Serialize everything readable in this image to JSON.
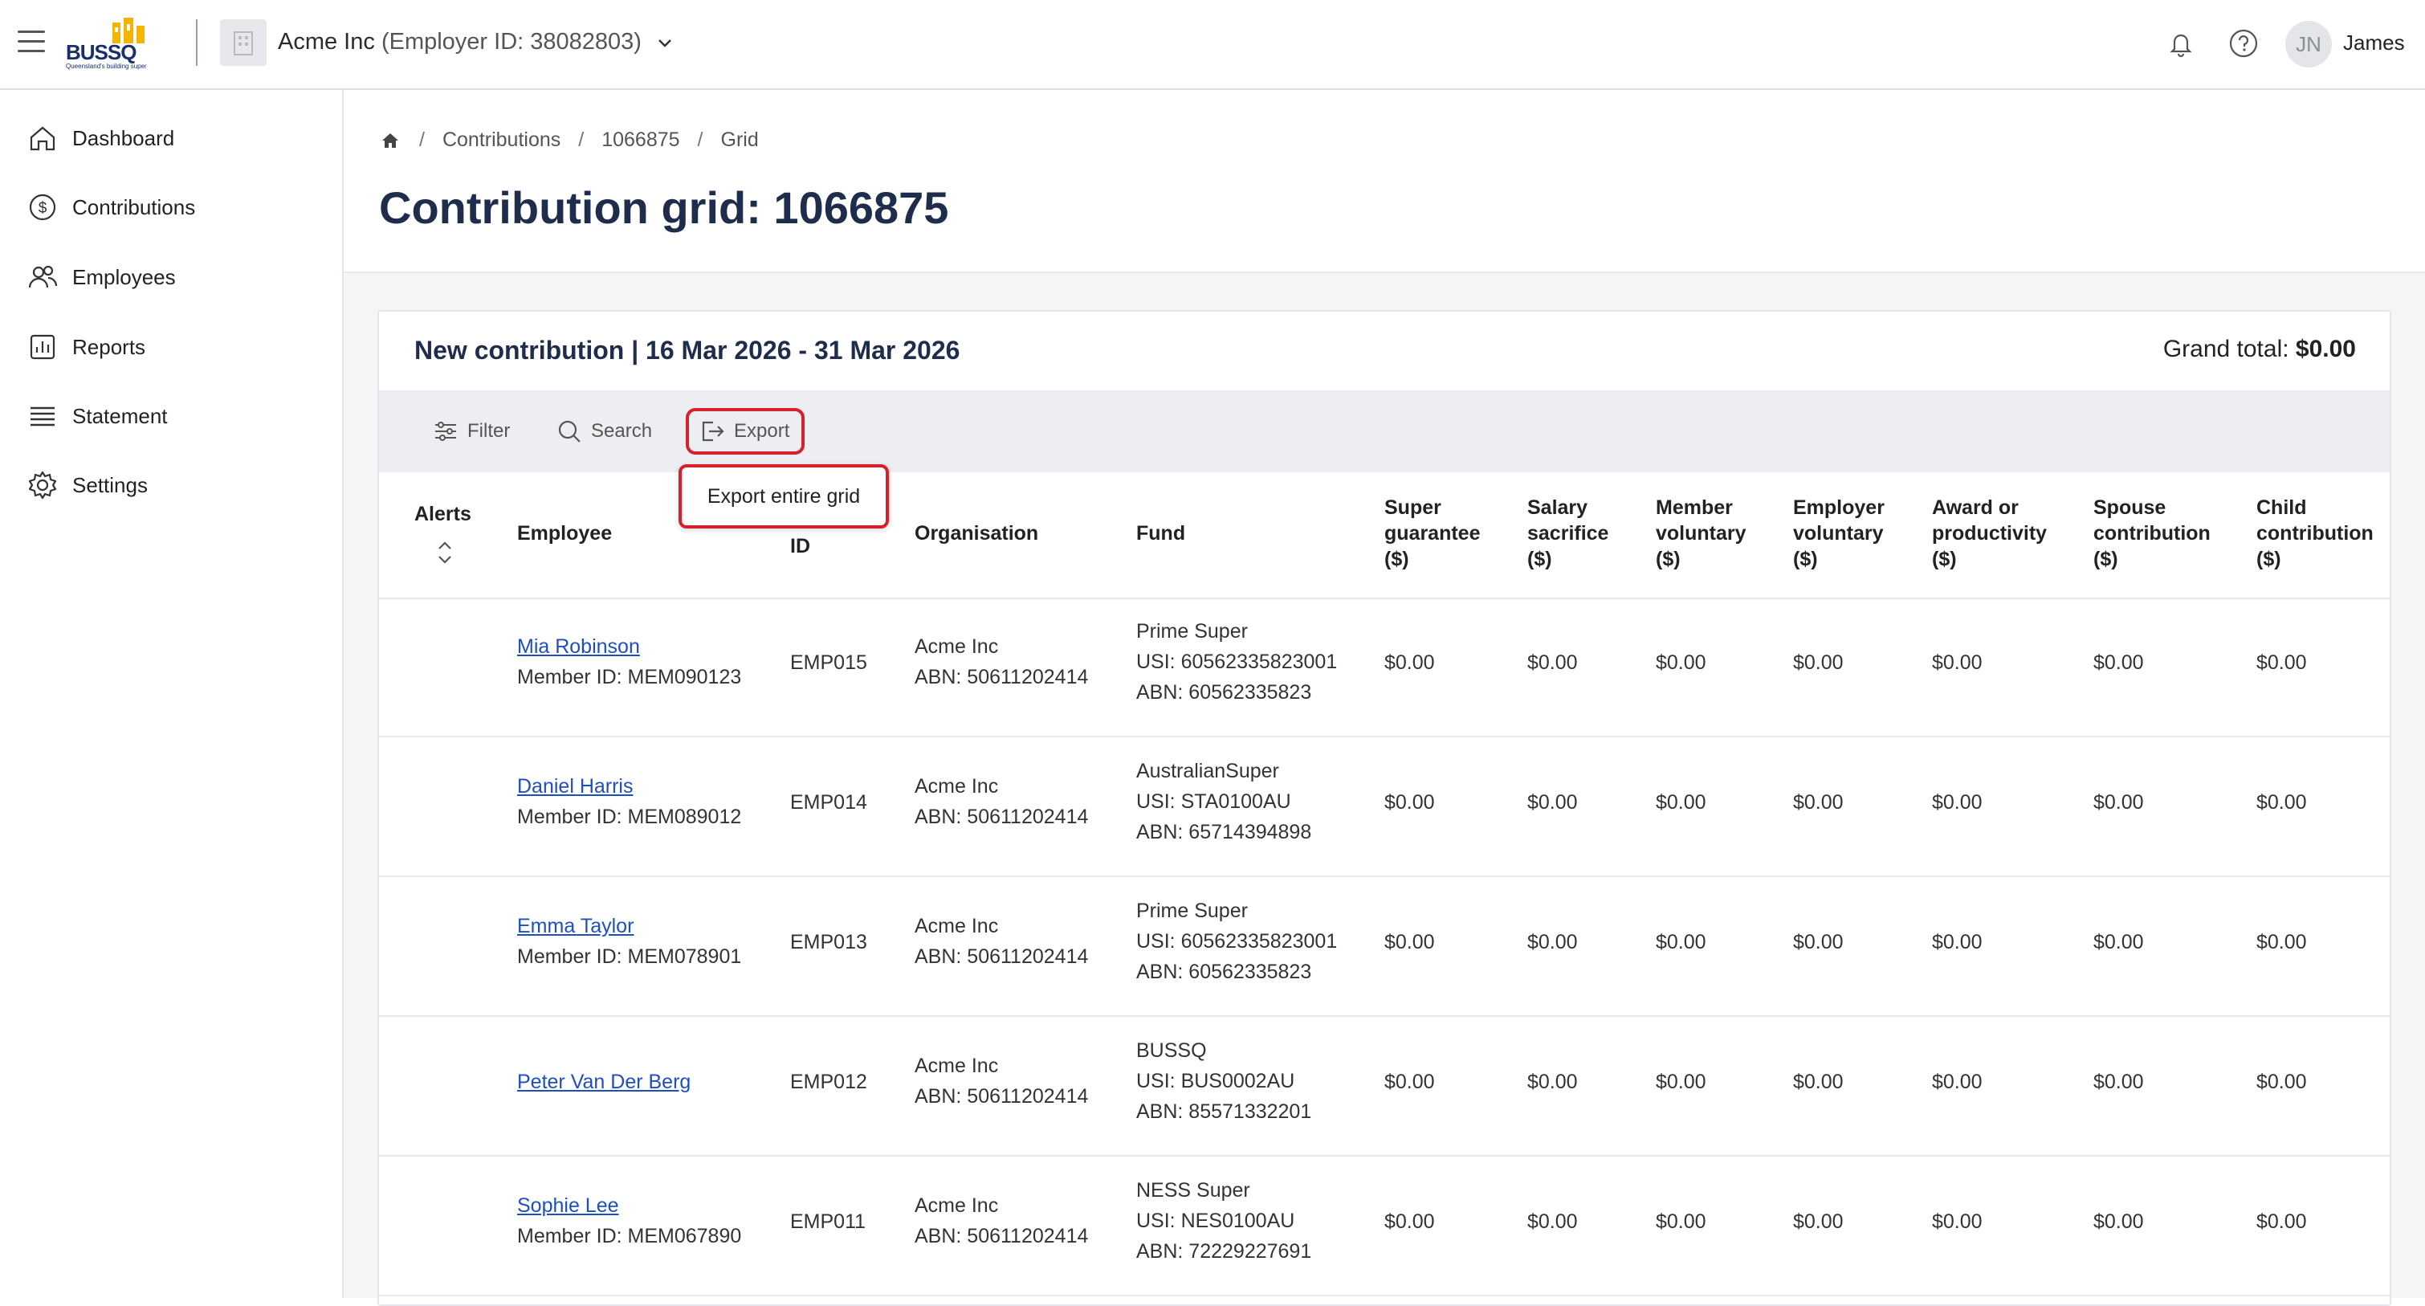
{
  "header": {
    "logo_text": "BUSSQ",
    "logo_tagline": "Queensland's building super",
    "org_name": "Acme Inc",
    "org_id_text": "(Employer ID: 38082803)",
    "avatar_initials": "JN",
    "user_name": "James"
  },
  "sidebar": {
    "items": [
      {
        "label": "Dashboard",
        "icon": "home-icon"
      },
      {
        "label": "Contributions",
        "icon": "dollar-circle-icon"
      },
      {
        "label": "Employees",
        "icon": "people-icon"
      },
      {
        "label": "Reports",
        "icon": "bar-chart-icon"
      },
      {
        "label": "Statement",
        "icon": "list-icon"
      },
      {
        "label": "Settings",
        "icon": "gear-icon"
      }
    ]
  },
  "breadcrumb": [
    "Contributions",
    "1066875",
    "Grid"
  ],
  "page_title": "Contribution grid: 1066875",
  "card": {
    "title": "New contribution | 16 Mar 2026 - 31 Mar 2026",
    "grand_total_label": "Grand total:",
    "grand_total_value": "$0.00"
  },
  "toolbar": {
    "filter_label": "Filter",
    "search_label": "Search",
    "export_label": "Export",
    "export_menu_item": "Export entire grid"
  },
  "table": {
    "headers": {
      "alerts": "Alerts",
      "employee": "Employee",
      "payroll_id_partial": "ID",
      "organisation": "Organisation",
      "fund": "Fund",
      "super_guarantee": [
        "Super",
        "guarantee",
        "($)"
      ],
      "salary_sacrifice": [
        "Salary",
        "sacrifice",
        "($)"
      ],
      "member_voluntary": [
        "Member",
        "voluntary",
        "($)"
      ],
      "employer_voluntary": [
        "Employer",
        "voluntary",
        "($)"
      ],
      "award_productivity": [
        "Award or",
        "productivity",
        "($)"
      ],
      "spouse_contribution": [
        "Spouse",
        "contribution",
        "($)"
      ],
      "child_contribution": [
        "Child",
        "contribution",
        "($)"
      ]
    },
    "rows": [
      {
        "name": "Mia Robinson",
        "member_id": "Member ID: MEM090123",
        "emp_id": "EMP015",
        "org": "Acme Inc",
        "abn": "ABN: 50611202414",
        "fund": "Prime Super",
        "usi": "USI: 60562335823001",
        "fund_abn": "ABN: 60562335823",
        "sg": "$0.00",
        "ss": "$0.00",
        "mv": "$0.00",
        "ev": "$0.00",
        "ap": "$0.00",
        "sc": "$0.00",
        "cc": "$0.00"
      },
      {
        "name": "Daniel Harris",
        "member_id": "Member ID: MEM089012",
        "emp_id": "EMP014",
        "org": "Acme Inc",
        "abn": "ABN: 50611202414",
        "fund": "AustralianSuper",
        "usi": "USI: STA0100AU",
        "fund_abn": "ABN: 65714394898",
        "sg": "$0.00",
        "ss": "$0.00",
        "mv": "$0.00",
        "ev": "$0.00",
        "ap": "$0.00",
        "sc": "$0.00",
        "cc": "$0.00"
      },
      {
        "name": "Emma Taylor",
        "member_id": "Member ID: MEM078901",
        "emp_id": "EMP013",
        "org": "Acme Inc",
        "abn": "ABN: 50611202414",
        "fund": "Prime Super",
        "usi": "USI: 60562335823001",
        "fund_abn": "ABN: 60562335823",
        "sg": "$0.00",
        "ss": "$0.00",
        "mv": "$0.00",
        "ev": "$0.00",
        "ap": "$0.00",
        "sc": "$0.00",
        "cc": "$0.00"
      },
      {
        "name": "Peter Van Der Berg",
        "member_id": "",
        "emp_id": "EMP012",
        "org": "Acme Inc",
        "abn": "ABN: 50611202414",
        "fund": "BUSSQ",
        "usi": "USI: BUS0002AU",
        "fund_abn": "ABN: 85571332201",
        "sg": "$0.00",
        "ss": "$0.00",
        "mv": "$0.00",
        "ev": "$0.00",
        "ap": "$0.00",
        "sc": "$0.00",
        "cc": "$0.00"
      },
      {
        "name": "Sophie Lee",
        "member_id": "Member ID: MEM067890",
        "emp_id": "EMP011",
        "org": "Acme Inc",
        "abn": "ABN: 50611202414",
        "fund": "NESS Super",
        "usi": "USI: NES0100AU",
        "fund_abn": "ABN: 72229227691",
        "sg": "$0.00",
        "ss": "$0.00",
        "mv": "$0.00",
        "ev": "$0.00",
        "ap": "$0.00",
        "sc": "$0.00",
        "cc": "$0.00"
      }
    ]
  },
  "colors": {
    "title": "#1f2d4d",
    "link": "#1f4fbf",
    "highlight": "#d8202c",
    "toolbar_bg": "#eceef1"
  }
}
